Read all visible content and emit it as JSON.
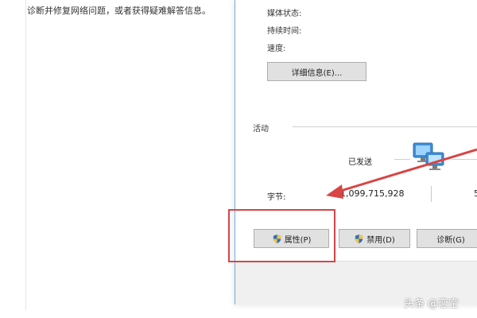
{
  "left_panel": {
    "help_text": "诊断并修复网络问题，或者获得疑难解答信息。"
  },
  "dialog": {
    "media_state_label": "媒体状态:",
    "duration_label": "持续时间:",
    "speed_label": "速度:",
    "details_button": "详细信息(E)...",
    "activity_section": "活动",
    "sent_label": "已发送",
    "bytes_label": "字节:",
    "bytes_sent": "1,099,715,928",
    "bytes_received_partial": "5",
    "buttons": {
      "properties": "属性(P)",
      "disable": "禁用(D)",
      "diagnose": "诊断(G)"
    }
  },
  "watermark": "头条 @恋空",
  "colors": {
    "highlight_box": "#d84545",
    "arrow": "#d84545",
    "dialog_border": "#7aa7d6"
  }
}
